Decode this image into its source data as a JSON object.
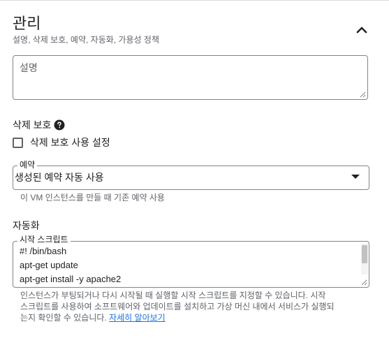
{
  "section": {
    "title": "관리",
    "subtitle": "설명, 삭제 보호, 예약, 자동화, 가용성 정책",
    "collapse_icon": "chevron-up-icon"
  },
  "description": {
    "placeholder": "설명"
  },
  "deletion_protection": {
    "heading": "삭제 보호",
    "help_icon": "help-circle-icon",
    "checkbox_label": "삭제 보호 사용 설정",
    "checked": false
  },
  "reservation": {
    "label": "예약",
    "value": "생성된 예약 자동 사용",
    "hint": "이 VM 인스턴스를 만들 때 기존 예약 사용"
  },
  "automation": {
    "heading": "자동화",
    "startup_label": "시작 스크립트",
    "script_lines": [
      "#! /bin/bash",
      "apt-get update",
      "apt-get install -y apache2"
    ],
    "help_lines": [
      "인스턴스가 부팅되거나 다시 시작될 때 실행할 시작 스크립트를 지정할 수 있습니다. 시작",
      "스크립트를 사용하여 소프트웨어와 업데이트를 설치하고 가상 머신 내에서 서비스가 실행되",
      "는지 확인할 수 있습니다."
    ],
    "learn_more": "자세히 알아보기"
  },
  "colors": {
    "link": "#1a73e8",
    "border": "#80868b",
    "muted_text": "#5f6368",
    "text": "#202124"
  }
}
